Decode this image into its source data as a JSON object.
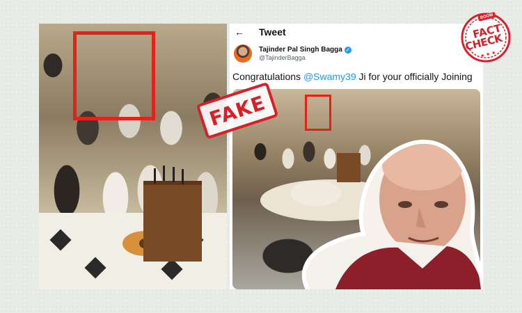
{
  "stamp": {
    "fake_label": "FAKE"
  },
  "factcheck": {
    "brand": "BOOM",
    "line1": "FACT",
    "line2": "CHECK",
    "stars": "★ ★ ★"
  },
  "tweet": {
    "header_title": "Tweet",
    "back_icon": "←",
    "author_name": "Tajinder Pal Singh Bagga",
    "author_handle": "@TajinderBagga",
    "verified_icon": "✓",
    "text_prefix": "Congratulations ",
    "mention": "@Swamy39",
    "text_suffix": " Ji for your officially Joining"
  },
  "colors": {
    "stamp_red": "#d8202a",
    "box_red": "#e2231a",
    "twitter_blue": "#1d9bf0"
  }
}
